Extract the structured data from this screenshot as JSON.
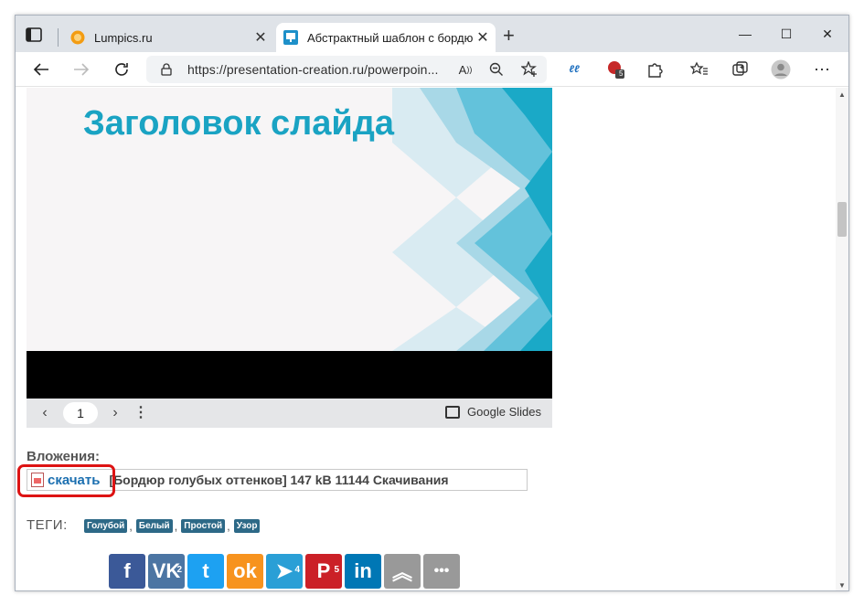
{
  "browser": {
    "tabs": [
      {
        "title": "Lumpics.ru",
        "active": false
      },
      {
        "title": "Абстрактный шаблон с бордюр",
        "active": true
      }
    ],
    "new_tab": "+",
    "close_glyph": "✕",
    "window_controls": {
      "minimize": "—",
      "maximize": "☐",
      "close": "✕"
    },
    "url": "https://presentation-creation.ru/powerpoin...",
    "toolbar_icons": [
      "back-icon",
      "forward-icon",
      "refresh-icon",
      "lock-icon",
      "read-aloud-icon",
      "zoom-icon",
      "add-favorite-icon",
      "extension-icon",
      "adblock-icon",
      "extensions-icon",
      "favorites-icon",
      "collections-icon",
      "profile-icon",
      "more-icon"
    ],
    "extension_badge": "5"
  },
  "slide": {
    "title": "Заголовок слайда",
    "colors": {
      "title": "#1aa3c3",
      "chevrons": [
        "#d7eaf2",
        "#9dd3e4",
        "#5dbfd9",
        "#1aa9c7"
      ]
    }
  },
  "viewer": {
    "page": "1",
    "brand": "Google Slides"
  },
  "attachments": {
    "heading": "Вложения:",
    "download_label": "скачать",
    "info": "[Бордюр голубых оттенков] 147 kB 11144 Скачивания"
  },
  "tags": {
    "label": "ТЕГИ:",
    "items": [
      "Голубой",
      "Белый",
      "Простой",
      "Узор"
    ],
    "separator": ","
  },
  "share": [
    {
      "name": "facebook",
      "glyph": "f",
      "color": "#3b5998",
      "count": ""
    },
    {
      "name": "vk",
      "glyph": "VK",
      "color": "#4c75a3",
      "count": "2"
    },
    {
      "name": "twitter",
      "glyph": "t",
      "color": "#1da1f2",
      "count": ""
    },
    {
      "name": "odnoklassniki",
      "glyph": "ok",
      "color": "#f7931e",
      "count": ""
    },
    {
      "name": "telegram",
      "glyph": "➤",
      "color": "#2a9fd6",
      "count": "4"
    },
    {
      "name": "pinterest",
      "glyph": "P",
      "color": "#cb2027",
      "count": "5"
    },
    {
      "name": "linkedin",
      "glyph": "in",
      "color": "#0077b5",
      "count": ""
    },
    {
      "name": "scroll-up",
      "glyph": "︽",
      "color": "#999999",
      "count": ""
    },
    {
      "name": "more",
      "glyph": "•••",
      "color": "#999999",
      "count": ""
    }
  ]
}
